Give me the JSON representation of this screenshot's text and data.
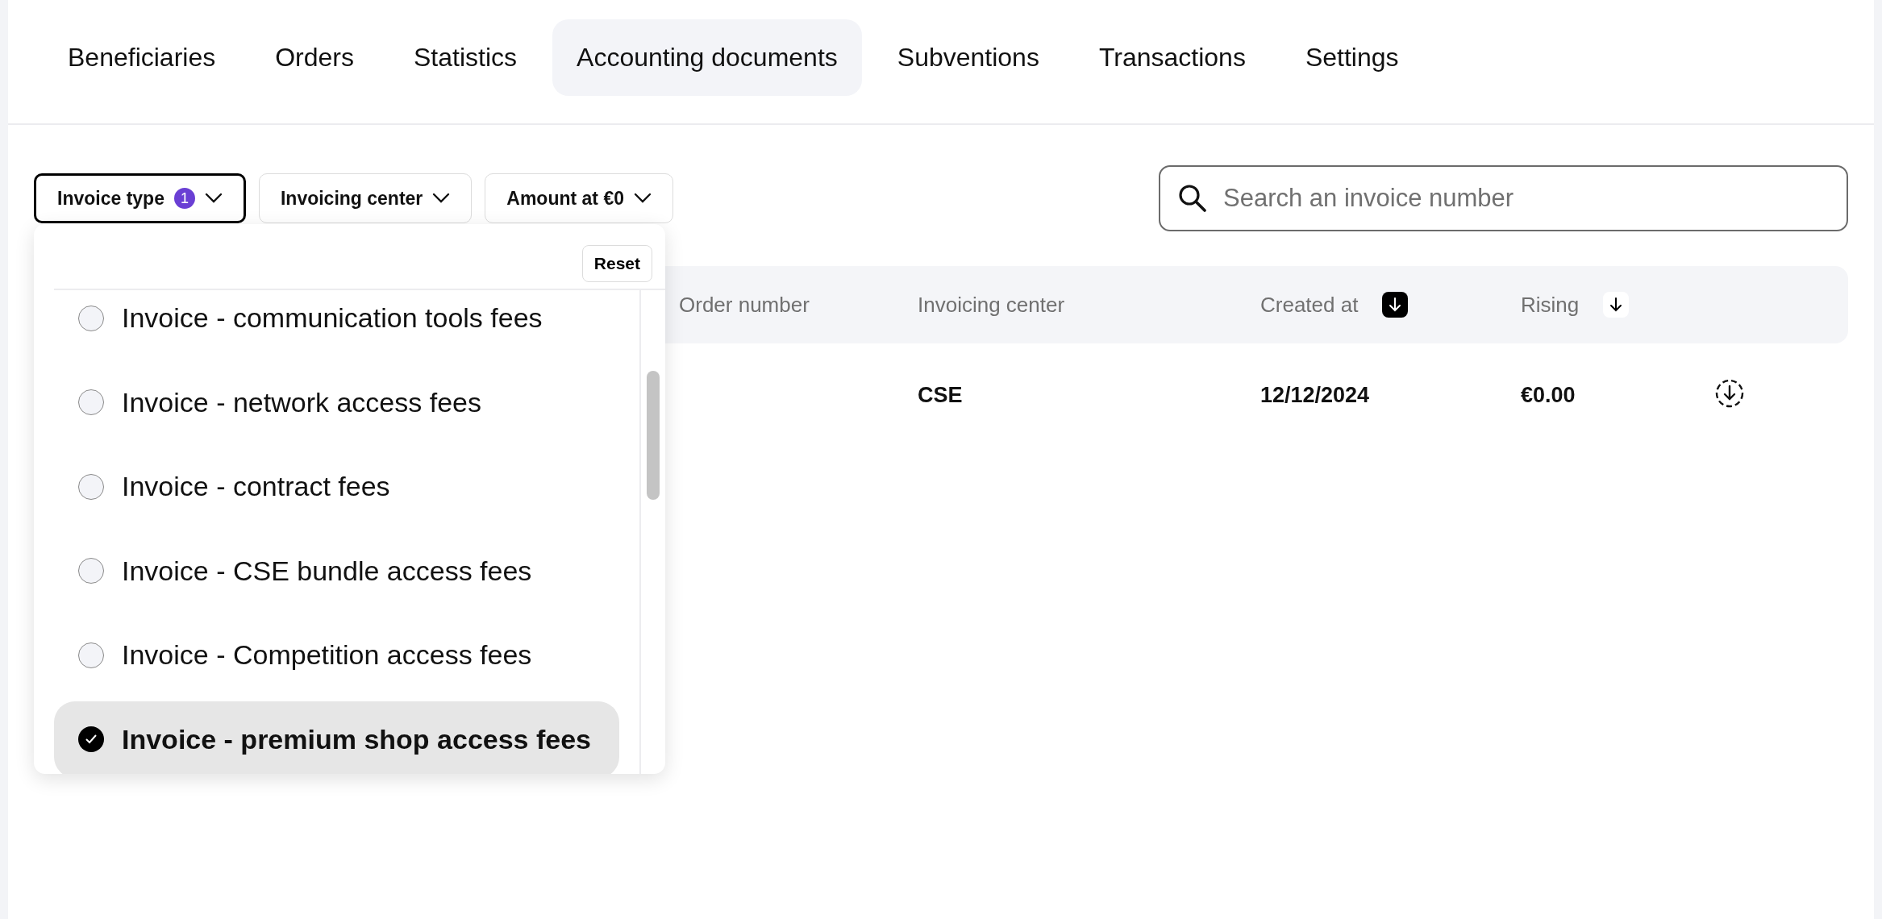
{
  "tabs": [
    {
      "label": "Beneficiaries",
      "selected": false
    },
    {
      "label": "Orders",
      "selected": false
    },
    {
      "label": "Statistics",
      "selected": false
    },
    {
      "label": "Accounting documents",
      "selected": true
    },
    {
      "label": "Subventions",
      "selected": false
    },
    {
      "label": "Transactions",
      "selected": false
    },
    {
      "label": "Settings",
      "selected": false
    }
  ],
  "filters": [
    {
      "label": "Invoice type",
      "badge": "1",
      "open": true
    },
    {
      "label": "Invoicing center",
      "open": false
    },
    {
      "label": "Amount at €0",
      "open": false
    }
  ],
  "search": {
    "placeholder": "Search an invoice number"
  },
  "dropdown": {
    "reset": "Reset",
    "options": [
      {
        "label": "Invoice - communication tools fees",
        "checked": false
      },
      {
        "label": "Invoice - network access fees",
        "checked": false
      },
      {
        "label": "Invoice - contract fees",
        "checked": false
      },
      {
        "label": "Invoice - CSE bundle access fees",
        "checked": false
      },
      {
        "label": "Invoice - Competition access fees",
        "checked": false
      },
      {
        "label": "Invoice - premium shop access fees",
        "checked": true
      }
    ]
  },
  "table": {
    "columns": [
      {
        "label": "Order number"
      },
      {
        "label": "Invoicing center"
      },
      {
        "label": "Created at",
        "selected": true
      },
      {
        "label": "Rising",
        "selected": false
      }
    ],
    "rows": [
      {
        "invoicing_center": "CSE",
        "created_at": "12/12/2024",
        "rising": "€0.00"
      }
    ]
  }
}
